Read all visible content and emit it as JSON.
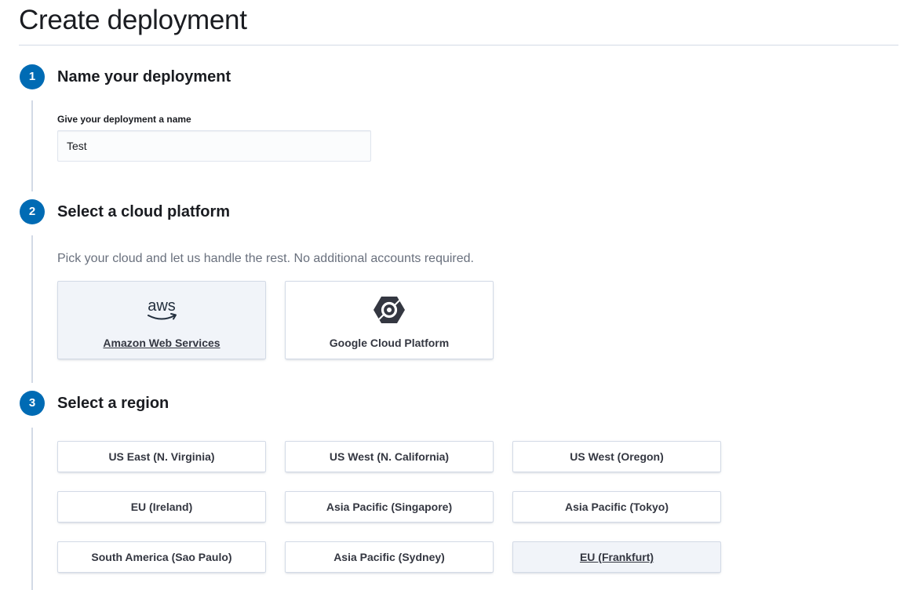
{
  "page": {
    "title": "Create deployment"
  },
  "steps": [
    {
      "number": "1",
      "title": "Name your deployment"
    },
    {
      "number": "2",
      "title": "Select a cloud platform"
    },
    {
      "number": "3",
      "title": "Select a region"
    }
  ],
  "name_step": {
    "label": "Give your deployment a name",
    "value": "Test"
  },
  "platform_step": {
    "description": "Pick your cloud and let us handle the rest. No additional accounts required.",
    "options": [
      {
        "label": "Amazon Web Services",
        "logo_text": "aws",
        "icon": "aws-logo-icon",
        "selected": true
      },
      {
        "label": "Google Cloud Platform",
        "icon": "google-cloud-logo-icon",
        "selected": false
      }
    ]
  },
  "region_step": {
    "options": [
      {
        "label": "US East (N. Virginia)",
        "selected": false
      },
      {
        "label": "US West (N. California)",
        "selected": false
      },
      {
        "label": "US West (Oregon)",
        "selected": false
      },
      {
        "label": "EU (Ireland)",
        "selected": false
      },
      {
        "label": "Asia Pacific (Singapore)",
        "selected": false
      },
      {
        "label": "Asia Pacific (Tokyo)",
        "selected": false
      },
      {
        "label": "South America (Sao Paulo)",
        "selected": false
      },
      {
        "label": "Asia Pacific (Sydney)",
        "selected": false
      },
      {
        "label": "EU (Frankfurt)",
        "selected": true
      }
    ]
  },
  "colors": {
    "accent": "#006bb4",
    "text": "#1a1c21",
    "subdued_text": "#69707d",
    "border": "#d3dae6",
    "selected_bg": "#f1f4f9"
  }
}
